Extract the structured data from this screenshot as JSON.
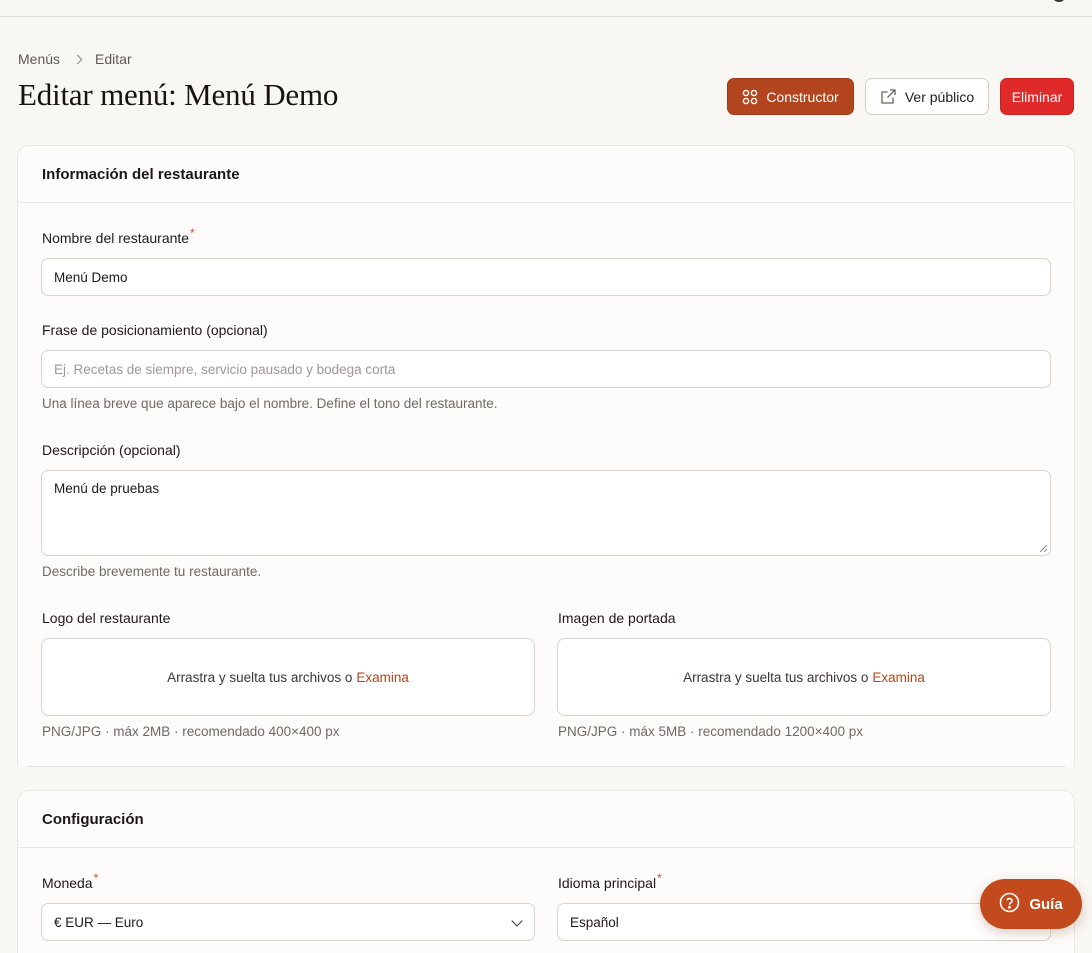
{
  "breadcrumb": {
    "items": [
      "Menús",
      "Editar"
    ]
  },
  "page": {
    "title": "Editar menú: Menú Demo"
  },
  "actions": {
    "builder_label": "Constructor",
    "view_public_label": "Ver público",
    "delete_label": "Eliminar"
  },
  "colors": {
    "accent": "#b2451e",
    "danger": "#e02a2a",
    "background": "#f9f7f3"
  },
  "restaurant_section": {
    "title": "Información del restaurante",
    "name": {
      "label": "Nombre del restaurante",
      "required_mark": "*",
      "value": "Menú Demo"
    },
    "tagline": {
      "label": "Frase de posicionamiento (opcional)",
      "placeholder": "Ej. Recetas de siempre, servicio pausado y bodega corta",
      "hint": "Una línea breve que aparece bajo el nombre. Define el tono del restaurante."
    },
    "description": {
      "label": "Descripción (opcional)",
      "value": "Menú de pruebas",
      "hint": "Describe brevemente tu restaurante."
    },
    "logo": {
      "label": "Logo del restaurante",
      "drop_text": "Arrastra y suelta tus archivos o",
      "browse_label": "Examina",
      "hint": "PNG/JPG · máx 2MB · recomendado 400×400 px"
    },
    "cover": {
      "label": "Imagen de portada",
      "drop_text": "Arrastra y suelta tus archivos o",
      "browse_label": "Examina",
      "hint": "PNG/JPG · máx 5MB · recomendado 1200×400 px"
    }
  },
  "config_section": {
    "title": "Configuración",
    "currency": {
      "label": "Moneda",
      "required_mark": "*",
      "value": "€ EUR — Euro"
    },
    "language": {
      "label": "Idioma principal",
      "required_mark": "*",
      "value": "Español"
    }
  },
  "guide_button": {
    "label": "Guía"
  }
}
